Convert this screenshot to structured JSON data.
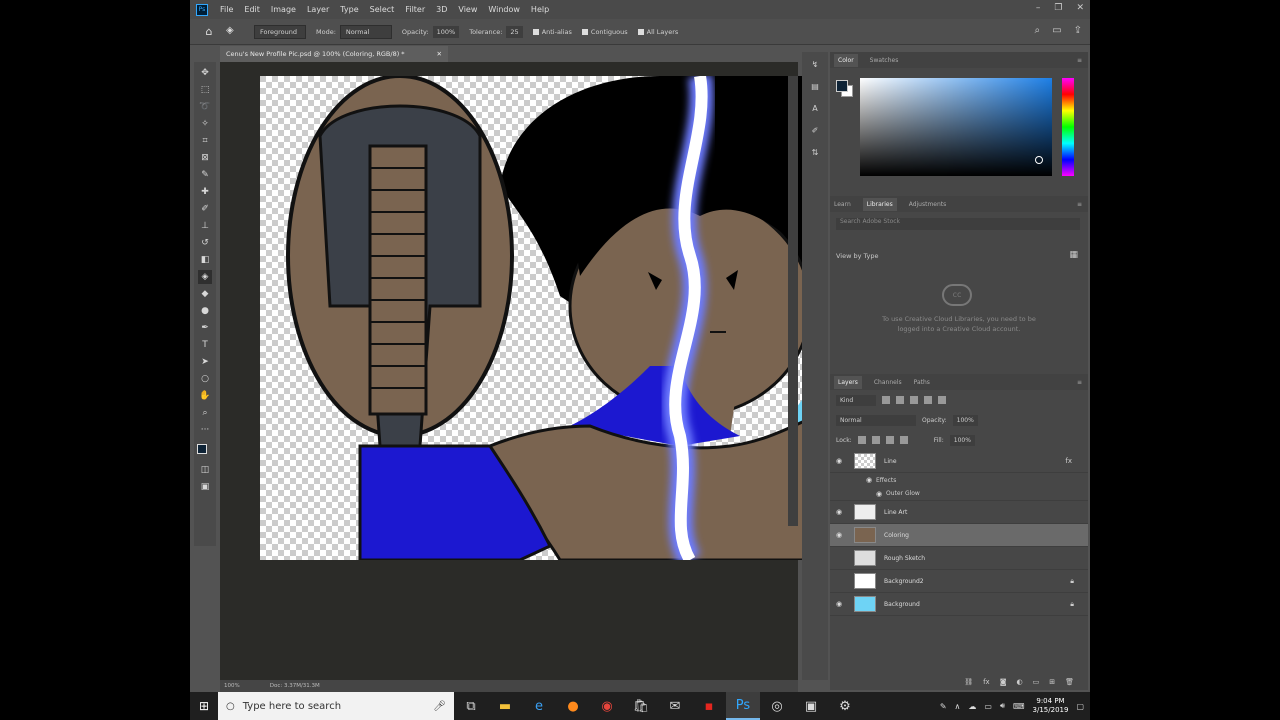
{
  "app": {
    "logo": "Ps",
    "menu": [
      "File",
      "Edit",
      "Image",
      "Layer",
      "Type",
      "Select",
      "Filter",
      "3D",
      "View",
      "Window",
      "Help"
    ]
  },
  "options": {
    "preset": "Foreground",
    "mode_label": "Mode:",
    "mode_value": "Normal",
    "opacity_label": "Opacity:",
    "opacity_value": "100%",
    "tolerance_label": "Tolerance:",
    "tolerance_value": "25",
    "anti_alias": "Anti-alias",
    "contiguous": "Contiguous",
    "all_layers": "All Layers"
  },
  "document": {
    "tab_title": "Cenu's New Profile Pic.psd @ 100% (Coloring, RGB/8) *",
    "zoom": "100%",
    "doc_size": "Doc: 3.37M/31.3M"
  },
  "color_panel": {
    "tabs": [
      "Color",
      "Swatches"
    ],
    "foreground": "#0e2336",
    "background": "#ffffff"
  },
  "libraries_panel": {
    "tabs": [
      "Learn",
      "Libraries",
      "Adjustments"
    ],
    "search_placeholder": "Search Adobe Stock",
    "view_by": "View by Type",
    "message": "To use Creative Cloud Libraries, you need to be logged into a Creative Cloud account."
  },
  "layers_panel": {
    "tabs": [
      "Layers",
      "Channels",
      "Paths"
    ],
    "kind": "Kind",
    "blend": "Normal",
    "opacity_label": "Opacity:",
    "opacity_value": "100%",
    "lock_label": "Lock:",
    "fill_label": "Fill:",
    "fill_value": "100%",
    "layers": [
      {
        "name": "Line",
        "visible": true
      },
      {
        "name": "Line Art",
        "visible": true
      },
      {
        "name": "Coloring",
        "visible": true,
        "selected": true
      },
      {
        "name": "Rough Sketch",
        "visible": false
      },
      {
        "name": "Background2",
        "visible": false,
        "locked": true
      },
      {
        "name": "Background",
        "visible": true,
        "locked": true
      }
    ],
    "effects_label": "Effects",
    "effect_name": "Outer Glow"
  },
  "taskbar": {
    "search_placeholder": "Type here to search",
    "time": "9:04 PM",
    "date": "3/15/2019"
  },
  "colors": {
    "canvas_skin": "#7a6450",
    "shirt_blue": "#1c18d0",
    "sky": "#6ed3f5",
    "accent": "#31a8ff"
  }
}
